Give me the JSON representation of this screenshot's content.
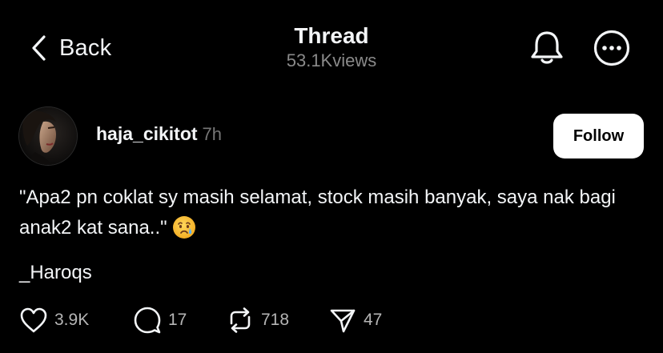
{
  "header": {
    "back_label": "Back",
    "title": "Thread",
    "views": "53.1Kviews",
    "back_icon": "chevron-left-icon",
    "notification_icon": "bell-icon",
    "more_icon": "more-options-icon"
  },
  "post": {
    "username": "haja_cikitot",
    "time": "7h",
    "follow_label": "Follow",
    "text": "\"Apa2 pn coklat sy masih selamat, stock masih banyak, saya nak bagi anak2 kat sana..\"",
    "emoji": "crying-face-emoji",
    "signature": "_Haroqs",
    "actions": {
      "likes": "3.9K",
      "replies": "17",
      "reposts": "718",
      "shares": "47"
    }
  },
  "colors": {
    "background": "#000000",
    "text": "#f3f5f7",
    "muted": "#8a8a8a",
    "follow_bg": "#ffffff",
    "follow_text": "#000000"
  }
}
